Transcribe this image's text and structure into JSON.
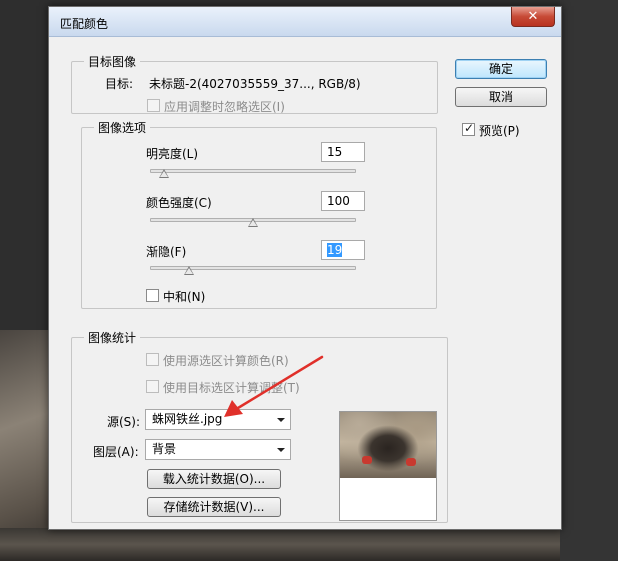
{
  "window": {
    "title": "匹配颜色",
    "close_symbol": "✕"
  },
  "target_group": {
    "label": "目标图像",
    "target_label": "目标:",
    "target_value": "未标题-2(4027035559_37..., RGB/8)",
    "ignore_selection_label": "应用调整时忽略选区(I)"
  },
  "image_options": {
    "label": "图像选项",
    "luminance": {
      "label": "明亮度(L)",
      "value": "15",
      "slider_fraction": 0.07
    },
    "color_intensity": {
      "label": "颜色强度(C)",
      "value": "100",
      "slider_fraction": 0.5
    },
    "fade": {
      "label": "渐隐(F)",
      "value": "19",
      "slider_fraction": 0.19
    },
    "neutralize_label": "中和(N)"
  },
  "image_stats": {
    "label": "图像统计",
    "use_source_selection_label": "使用源选区计算颜色(R)",
    "use_target_selection_label": "使用目标选区计算调整(T)",
    "source_label": "源(S):",
    "source_value": "蛛网铁丝.jpg",
    "layer_label": "图层(A):",
    "layer_value": "背景",
    "load_stats_label": "载入统计数据(O)...",
    "save_stats_label": "存储统计数据(V)..."
  },
  "buttons": {
    "ok_label": "确定",
    "cancel_label": "取消"
  },
  "preview_label": "预览(P)",
  "preview_checked": true,
  "check_symbol": "✓",
  "colors": {
    "accent_selection": "#3399ff",
    "annotation_arrow": "#e0302a"
  }
}
